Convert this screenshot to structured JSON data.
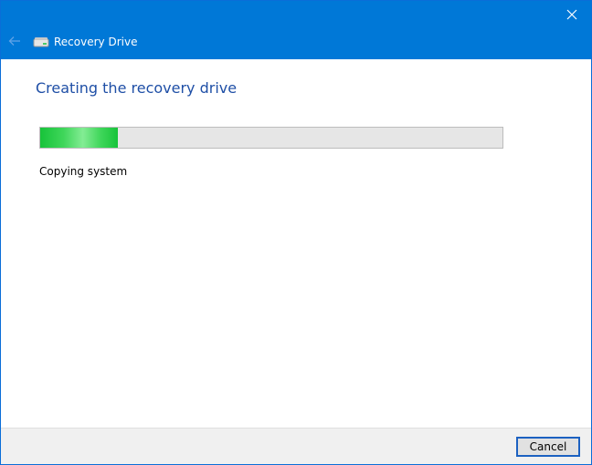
{
  "window": {
    "title": "Recovery Drive"
  },
  "main": {
    "heading": "Creating the recovery drive",
    "progress_fraction": 0.168,
    "status": "Copying system"
  },
  "footer": {
    "cancel_label": "Cancel"
  },
  "colors": {
    "titlebar": "#0078d7",
    "heading": "#1f4fa6",
    "progress_fill": "#2bd04a",
    "footer_bg": "#f0f0f0"
  }
}
